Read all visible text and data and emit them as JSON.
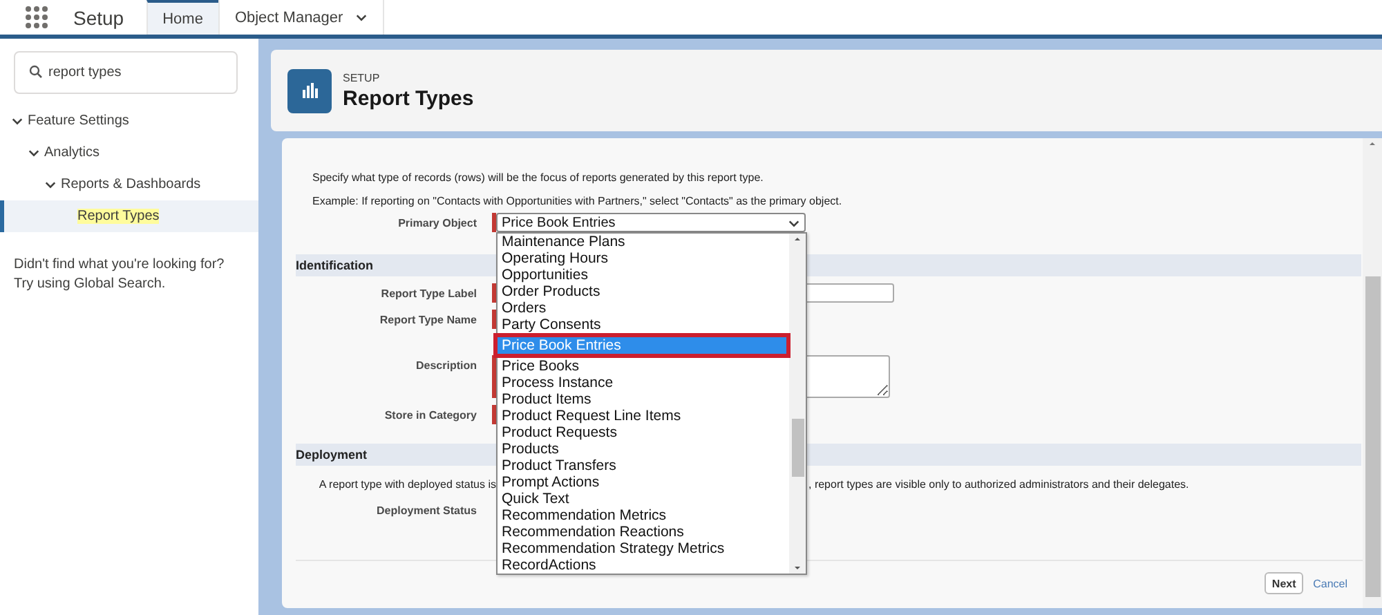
{
  "app": {
    "title": "Setup"
  },
  "tabs": [
    {
      "label": "Home",
      "selected": true,
      "kind": "link"
    },
    {
      "label": "Object Manager",
      "selected": false,
      "kind": "menu"
    }
  ],
  "sidebar": {
    "search": {
      "value": "report types"
    },
    "tree": [
      {
        "label": "Feature Settings",
        "expanded": true,
        "selected": false,
        "children": [
          {
            "label": "Analytics",
            "expanded": true,
            "selected": false,
            "children": [
              {
                "label": "Reports & Dashboards",
                "expanded": true,
                "selected": false,
                "children": [
                  {
                    "label": "Report Types",
                    "selected": true,
                    "highlighted": true
                  }
                ]
              }
            ]
          }
        ]
      }
    ],
    "help": [
      "Didn't find what you're looking for?",
      "Try using Global Search."
    ]
  },
  "header": {
    "eyebrow": "SETUP",
    "title": "Report Types"
  },
  "form": {
    "intro": [
      "Specify what type of records (rows) will be the focus of reports generated by this report type.",
      "Example: If reporting on \"Contacts with Opportunities with Partners,\" select \"Contacts\" as the primary object."
    ],
    "primary_object": {
      "label": "Primary Object",
      "value": "Price Book Entries",
      "required": true,
      "open": true,
      "options": [
        {
          "label": "Maintenance Plans",
          "selected": false
        },
        {
          "label": "Operating Hours",
          "selected": false
        },
        {
          "label": "Opportunities",
          "selected": false
        },
        {
          "label": "Order Products",
          "selected": false
        },
        {
          "label": "Orders",
          "selected": false
        },
        {
          "label": "Party Consents",
          "selected": false
        },
        {
          "label": "Price Book Entries",
          "selected": true
        },
        {
          "label": "Price Books",
          "selected": false
        },
        {
          "label": "Process Instance",
          "selected": false
        },
        {
          "label": "Product Items",
          "selected": false
        },
        {
          "label": "Product Request Line Items",
          "selected": false
        },
        {
          "label": "Product Requests",
          "selected": false
        },
        {
          "label": "Products",
          "selected": false
        },
        {
          "label": "Product Transfers",
          "selected": false
        },
        {
          "label": "Prompt Actions",
          "selected": false
        },
        {
          "label": "Quick Text",
          "selected": false
        },
        {
          "label": "Recommendation Metrics",
          "selected": false
        },
        {
          "label": "Recommendation Reactions",
          "selected": false
        },
        {
          "label": "Recommendation Strategy Metrics",
          "selected": false
        },
        {
          "label": "RecordActions",
          "selected": false
        }
      ]
    },
    "sections": [
      {
        "title": "Identification",
        "fields": [
          {
            "label": "Report Type Label",
            "kind": "input",
            "required": true
          },
          {
            "label": "Report Type Name",
            "required": true
          },
          {
            "label": "Description",
            "kind": "textarea",
            "required": true
          },
          {
            "label": "Store in Category",
            "required": true
          }
        ]
      },
      {
        "title": "Deployment",
        "text_before": "A report type with deployed status is",
        "text_after": ", report types are visible only to authorized administrators and their delegates.",
        "fields": [
          {
            "label": "Deployment Status",
            "required": false
          }
        ]
      }
    ],
    "buttons": [
      {
        "label": "Next",
        "kind": "button"
      },
      {
        "label": "Cancel",
        "kind": "link"
      }
    ]
  }
}
